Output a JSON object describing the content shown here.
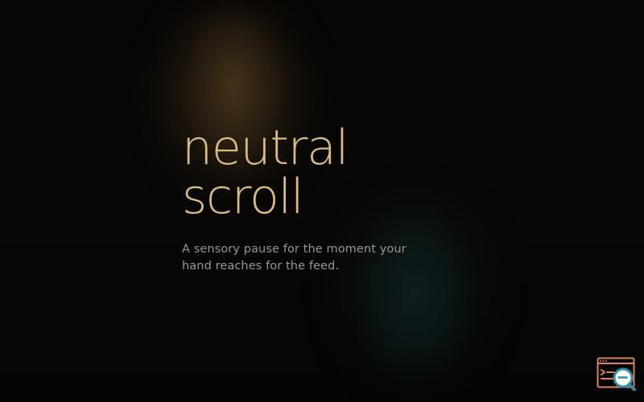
{
  "hero": {
    "title_line_1": "neutral",
    "title_line_2": "scroll",
    "subtitle_line_1": "A sensory pause for the moment your",
    "subtitle_line_2": "hand reaches for the feed."
  },
  "theme": {
    "background": "#070605",
    "accent_gold": "#d7bc84",
    "subtitle_gray": "#99958f",
    "warm_glow": "#5c4422",
    "cool_glow": "#122a2c",
    "tool_orange": "#d9825c",
    "tool_teal": "#2b8da2"
  },
  "corner_tool": {
    "icon": "browser-search-icon"
  }
}
